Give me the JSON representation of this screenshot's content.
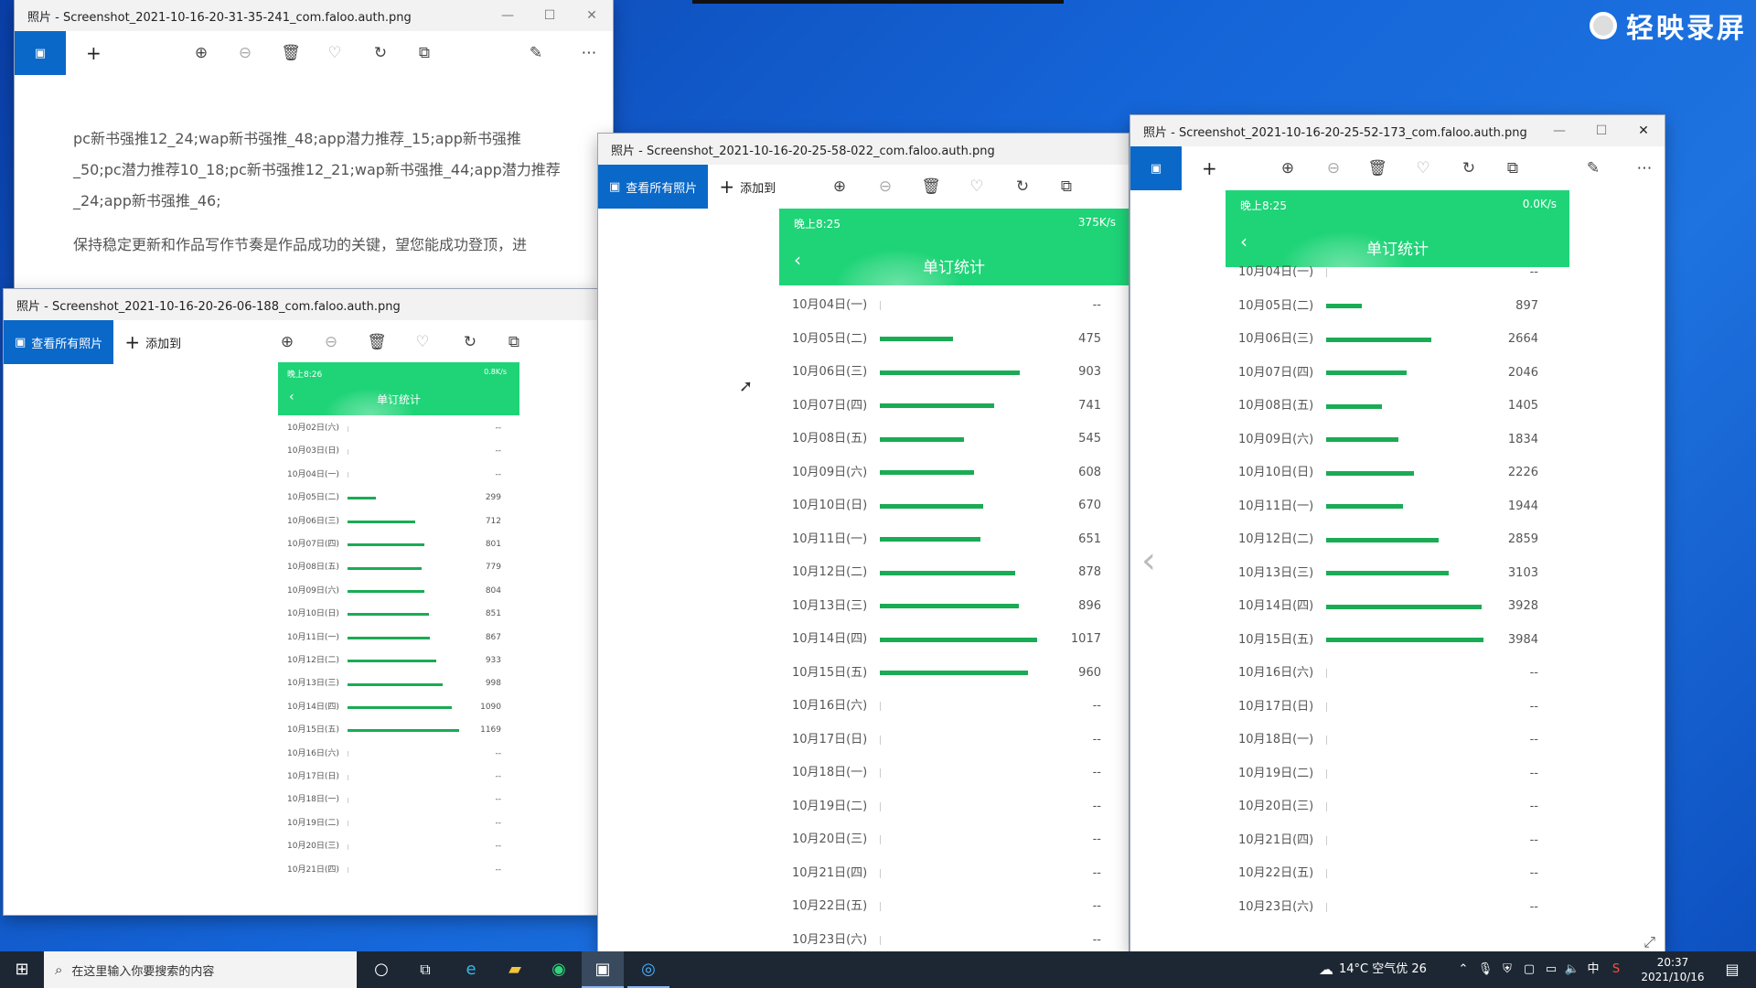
{
  "desktop": {
    "watermark": "轻映录屏"
  },
  "win1": {
    "title": "照片 - Screenshot_2021-10-16-20-31-35-241_com.faloo.auth.png",
    "para1": "pc新书强推12_24;wap新书强推_48;app潜力推荐_15;app新书强推_50;pc潜力推荐10_18;pc新书强推12_21;wap新书强推_44;app潜力推荐_24;app新书强推_46;",
    "para2": "保持稳定更新和作品写作节奏是作品成功的关键，望您能成功登顶，进"
  },
  "win2": {
    "title": "照片 - Screenshot_2021-10-16-20-26-06-188_com.faloo.auth.png",
    "view_all": "查看所有照片",
    "add_to": "添加到",
    "phone": {
      "time": "晚上8:26",
      "net": "0.8K/s",
      "title": "单订统计"
    },
    "rows": [
      {
        "d": "10月02日(六)",
        "v": "--",
        "n": 0
      },
      {
        "d": "10月03日(日)",
        "v": "--",
        "n": 0
      },
      {
        "d": "10月04日(一)",
        "v": "--",
        "n": 0
      },
      {
        "d": "10月05日(二)",
        "v": "299",
        "n": 299
      },
      {
        "d": "10月06日(三)",
        "v": "712",
        "n": 712
      },
      {
        "d": "10月07日(四)",
        "v": "801",
        "n": 801
      },
      {
        "d": "10月08日(五)",
        "v": "779",
        "n": 779
      },
      {
        "d": "10月09日(六)",
        "v": "804",
        "n": 804
      },
      {
        "d": "10月10日(日)",
        "v": "851",
        "n": 851
      },
      {
        "d": "10月11日(一)",
        "v": "867",
        "n": 867
      },
      {
        "d": "10月12日(二)",
        "v": "933",
        "n": 933
      },
      {
        "d": "10月13日(三)",
        "v": "998",
        "n": 998
      },
      {
        "d": "10月14日(四)",
        "v": "1090",
        "n": 1090
      },
      {
        "d": "10月15日(五)",
        "v": "1169",
        "n": 1169
      },
      {
        "d": "10月16日(六)",
        "v": "--",
        "n": 0
      },
      {
        "d": "10月17日(日)",
        "v": "--",
        "n": 0
      },
      {
        "d": "10月18日(一)",
        "v": "--",
        "n": 0
      },
      {
        "d": "10月19日(二)",
        "v": "--",
        "n": 0
      },
      {
        "d": "10月20日(三)",
        "v": "--",
        "n": 0
      },
      {
        "d": "10月21日(四)",
        "v": "--",
        "n": 0
      }
    ]
  },
  "win3": {
    "title": "照片 - Screenshot_2021-10-16-20-25-58-022_com.faloo.auth.png",
    "view_all": "查看所有照片",
    "add_to": "添加到",
    "phone": {
      "time": "晚上8:25",
      "net": "375K/s",
      "title": "单订统计"
    },
    "rows": [
      {
        "d": "10月04日(一)",
        "v": "--",
        "n": 0
      },
      {
        "d": "10月05日(二)",
        "v": "475",
        "n": 475
      },
      {
        "d": "10月06日(三)",
        "v": "903",
        "n": 903
      },
      {
        "d": "10月07日(四)",
        "v": "741",
        "n": 741
      },
      {
        "d": "10月08日(五)",
        "v": "545",
        "n": 545
      },
      {
        "d": "10月09日(六)",
        "v": "608",
        "n": 608
      },
      {
        "d": "10月10日(日)",
        "v": "670",
        "n": 670
      },
      {
        "d": "10月11日(一)",
        "v": "651",
        "n": 651
      },
      {
        "d": "10月12日(二)",
        "v": "878",
        "n": 878
      },
      {
        "d": "10月13日(三)",
        "v": "896",
        "n": 896
      },
      {
        "d": "10月14日(四)",
        "v": "1017",
        "n": 1017
      },
      {
        "d": "10月15日(五)",
        "v": "960",
        "n": 960
      },
      {
        "d": "10月16日(六)",
        "v": "--",
        "n": 0
      },
      {
        "d": "10月17日(日)",
        "v": "--",
        "n": 0
      },
      {
        "d": "10月18日(一)",
        "v": "--",
        "n": 0
      },
      {
        "d": "10月19日(二)",
        "v": "--",
        "n": 0
      },
      {
        "d": "10月20日(三)",
        "v": "--",
        "n": 0
      },
      {
        "d": "10月21日(四)",
        "v": "--",
        "n": 0
      },
      {
        "d": "10月22日(五)",
        "v": "--",
        "n": 0
      },
      {
        "d": "10月23日(六)",
        "v": "--",
        "n": 0
      }
    ]
  },
  "win4": {
    "title": "照片 - Screenshot_2021-10-16-20-25-52-173_com.faloo.auth.png",
    "phone": {
      "time": "晚上8:25",
      "net": "0.0K/s",
      "title": "单订统计"
    },
    "rows": [
      {
        "d": "10月04日(一)",
        "v": "--",
        "n": 0
      },
      {
        "d": "10月05日(二)",
        "v": "897",
        "n": 897
      },
      {
        "d": "10月06日(三)",
        "v": "2664",
        "n": 2664
      },
      {
        "d": "10月07日(四)",
        "v": "2046",
        "n": 2046
      },
      {
        "d": "10月08日(五)",
        "v": "1405",
        "n": 1405
      },
      {
        "d": "10月09日(六)",
        "v": "1834",
        "n": 1834
      },
      {
        "d": "10月10日(日)",
        "v": "2226",
        "n": 2226
      },
      {
        "d": "10月11日(一)",
        "v": "1944",
        "n": 1944
      },
      {
        "d": "10月12日(二)",
        "v": "2859",
        "n": 2859
      },
      {
        "d": "10月13日(三)",
        "v": "3103",
        "n": 3103
      },
      {
        "d": "10月14日(四)",
        "v": "3928",
        "n": 3928
      },
      {
        "d": "10月15日(五)",
        "v": "3984",
        "n": 3984
      },
      {
        "d": "10月16日(六)",
        "v": "--",
        "n": 0
      },
      {
        "d": "10月17日(日)",
        "v": "--",
        "n": 0
      },
      {
        "d": "10月18日(一)",
        "v": "--",
        "n": 0
      },
      {
        "d": "10月19日(二)",
        "v": "--",
        "n": 0
      },
      {
        "d": "10月20日(三)",
        "v": "--",
        "n": 0
      },
      {
        "d": "10月21日(四)",
        "v": "--",
        "n": 0
      },
      {
        "d": "10月22日(五)",
        "v": "--",
        "n": 0
      },
      {
        "d": "10月23日(六)",
        "v": "--",
        "n": 0
      }
    ]
  },
  "taskbar": {
    "search_placeholder": "在这里输入你要搜索的内容",
    "weather": "14°C 空气优 26",
    "ime": "中",
    "time": "20:37",
    "date": "2021/10/16"
  }
}
